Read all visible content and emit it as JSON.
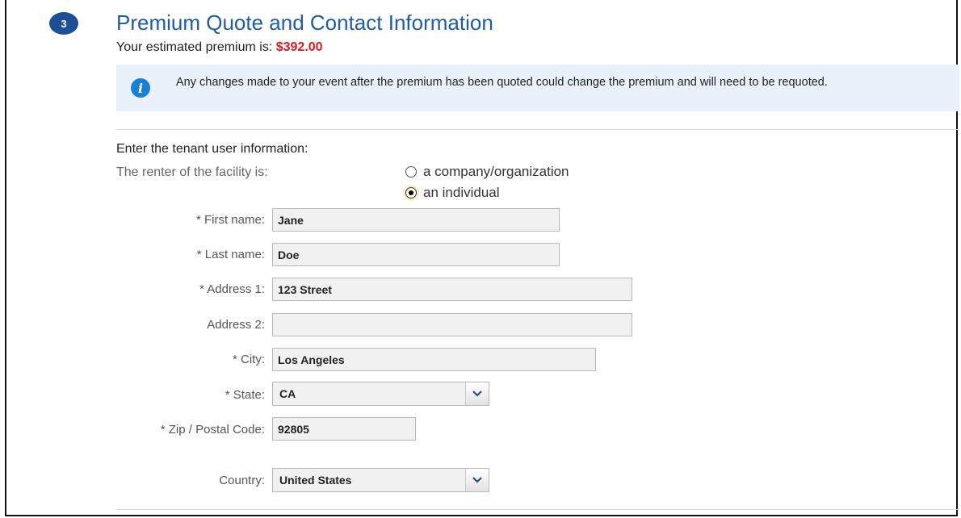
{
  "step": {
    "number": "3",
    "title": "Premium Quote and Contact Information"
  },
  "premium": {
    "label": "Your estimated premium is:",
    "amount": "$392.00"
  },
  "notice": {
    "icon": "info-icon",
    "text": "Any changes made to your event after the premium has been quoted could change the premium and will need to be requoted."
  },
  "tenant": {
    "heading": "Enter the tenant user information:",
    "renter_label": "The renter of the facility is:",
    "options": [
      {
        "label": "a company/organization",
        "selected": false
      },
      {
        "label": "an individual",
        "selected": true
      }
    ]
  },
  "fields": {
    "first_name": {
      "label": "* First name:",
      "value": "Jane"
    },
    "last_name": {
      "label": "* Last name:",
      "value": "Doe"
    },
    "address1": {
      "label": "* Address 1:",
      "value": "123 Street"
    },
    "address2": {
      "label": "Address 2:",
      "value": ""
    },
    "city": {
      "label": "* City:",
      "value": "Los Angeles"
    },
    "state": {
      "label": "* State:",
      "value": "CA"
    },
    "zip": {
      "label": "* Zip / Postal Code:",
      "value": "92805"
    },
    "country": {
      "label": "Country:",
      "value": "United States"
    }
  },
  "colors": {
    "accent": "#1e5ca8",
    "badge": "#1d4f96",
    "price": "#e0181d",
    "notice_bg": "#e9f2fb"
  }
}
